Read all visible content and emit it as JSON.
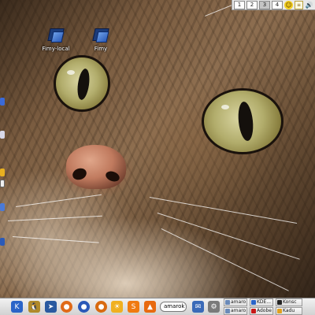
{
  "wallpaper": {
    "subject": "tabby cat close-up"
  },
  "desktop_icons": [
    {
      "label": "Fimy-local",
      "icon": "folder-icon"
    },
    {
      "label": "Fimy",
      "icon": "folder-icon"
    }
  ],
  "pager": {
    "desktops": [
      "1",
      "2",
      "3",
      "4"
    ],
    "active_index": 2,
    "tray": {
      "smiley": "☺",
      "note": "≡",
      "speaker": "🔊"
    }
  },
  "taskbar": {
    "launchers": [
      {
        "name": "kde-menu",
        "glyph": "K",
        "color": "#2a64c8"
      },
      {
        "name": "tux",
        "glyph": "🐧",
        "color": "#b08a2a"
      },
      {
        "name": "arrow",
        "glyph": "➤",
        "color": "#2a5aa0"
      },
      {
        "name": "firefox",
        "glyph": "●",
        "color": "#e06a18"
      },
      {
        "name": "thunderbird",
        "glyph": "●",
        "color": "#2a58b8"
      },
      {
        "name": "gimp",
        "glyph": "●",
        "color": "#d86a10"
      },
      {
        "name": "sun",
        "glyph": "☀",
        "color": "#f0b020"
      },
      {
        "name": "skype",
        "glyph": "S",
        "color": "#f07a10"
      },
      {
        "name": "vlc",
        "glyph": "▲",
        "color": "#e86a10"
      }
    ],
    "search_value": "amarok",
    "tray_launchers": [
      {
        "name": "mail",
        "glyph": "✉",
        "color": "#3a6ab8"
      },
      {
        "name": "gear",
        "glyph": "⚙",
        "color": "#7a7a7a"
      }
    ],
    "tasks": [
      {
        "label": "amaro",
        "color": "#6a8ab8"
      },
      {
        "label": "KDE...",
        "color": "#2a64c8"
      },
      {
        "label": "Konsc",
        "color": "#222222"
      },
      {
        "label": "amaro",
        "color": "#6a8ab8"
      },
      {
        "label": "Adobe",
        "color": "#c81818"
      },
      {
        "label": "Kadu",
        "color": "#e0a020"
      }
    ]
  }
}
